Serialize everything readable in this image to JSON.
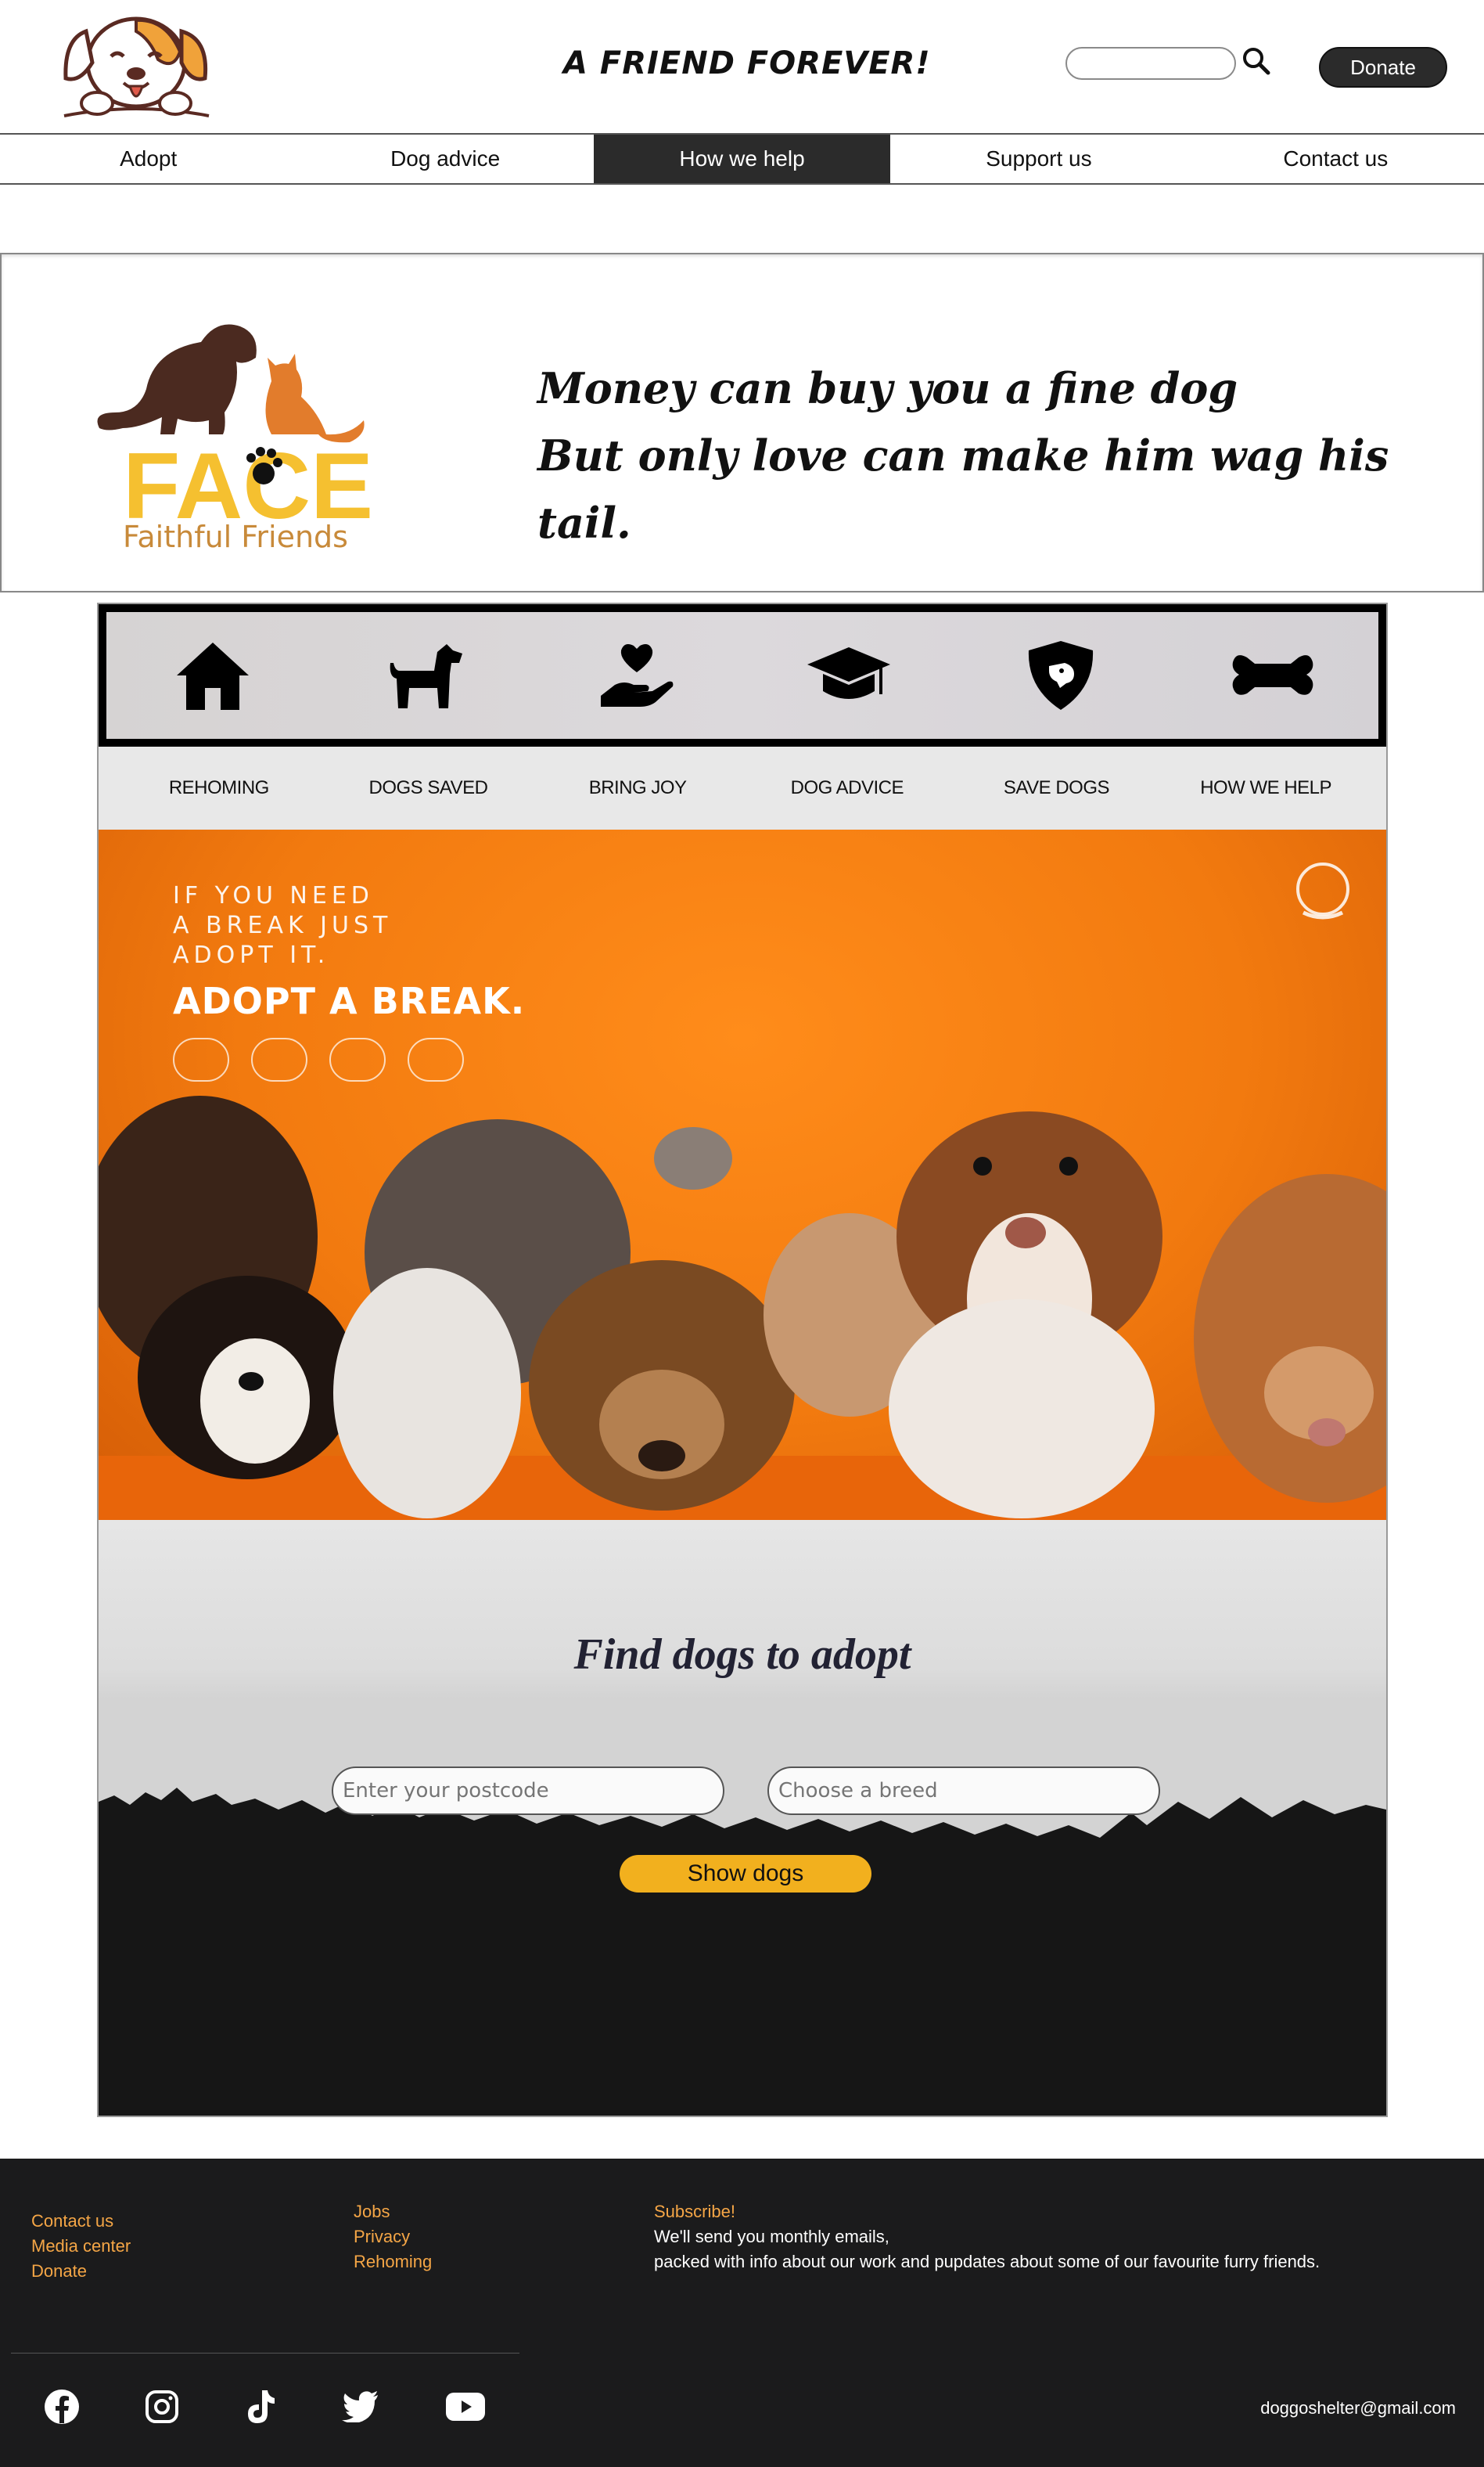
{
  "header": {
    "title": "A FRIEND FOREVER!",
    "search_placeholder": "",
    "donate_label": "Donate"
  },
  "nav": {
    "items": [
      {
        "label": "Adopt"
      },
      {
        "label": "Dog advice"
      },
      {
        "label": "How we help",
        "active": true
      },
      {
        "label": "Support us"
      },
      {
        "label": "Contact us"
      }
    ]
  },
  "banner": {
    "logo_text": "FACE",
    "logo_subtext": "Faithful Friends",
    "quote_line1": "Money can buy you a fine dog",
    "quote_line2": "But only love can make him wag his tail."
  },
  "features": {
    "items": [
      {
        "label": "REHOMING",
        "icon": "house-icon"
      },
      {
        "label": "DOGS SAVED",
        "icon": "dog-icon"
      },
      {
        "label": "BRING JOY",
        "icon": "heart-hand-icon"
      },
      {
        "label": "DOG ADVICE",
        "icon": "graduation-cap-icon"
      },
      {
        "label": "SAVE DOGS",
        "icon": "shield-dog-icon"
      },
      {
        "label": "HOW WE HELP",
        "icon": "bone-icon"
      }
    ]
  },
  "hero": {
    "line1": "IF YOU NEED",
    "line2": "A BREAK JUST",
    "line3": "ADOPT IT.",
    "headline": "ADOPT A BREAK."
  },
  "find": {
    "title": "Find dogs to adopt",
    "postcode_placeholder": "Enter your postcode",
    "breed_placeholder": "Choose a breed",
    "button_label": "Show dogs"
  },
  "footer": {
    "col1": [
      "Contact us",
      "Media center",
      "Donate"
    ],
    "col2": [
      "Jobs",
      "Privacy",
      "Rehoming"
    ],
    "subscribe_title": "Subscribe!",
    "subscribe_line1": "We'll send you monthly emails,",
    "subscribe_line2": "packed with info about our work and pupdates about some of our favourite furry friends.",
    "email": "doggoshelter@gmail.com",
    "social": [
      "facebook-icon",
      "instagram-icon",
      "tiktok-icon",
      "twitter-icon",
      "youtube-icon"
    ]
  },
  "colors": {
    "accent": "#f5a646",
    "dark": "#2b2b2b",
    "footer_bg": "#1b1b1c",
    "button_yellow": "#f2b01e",
    "hero_orange": "#f27a0f"
  }
}
